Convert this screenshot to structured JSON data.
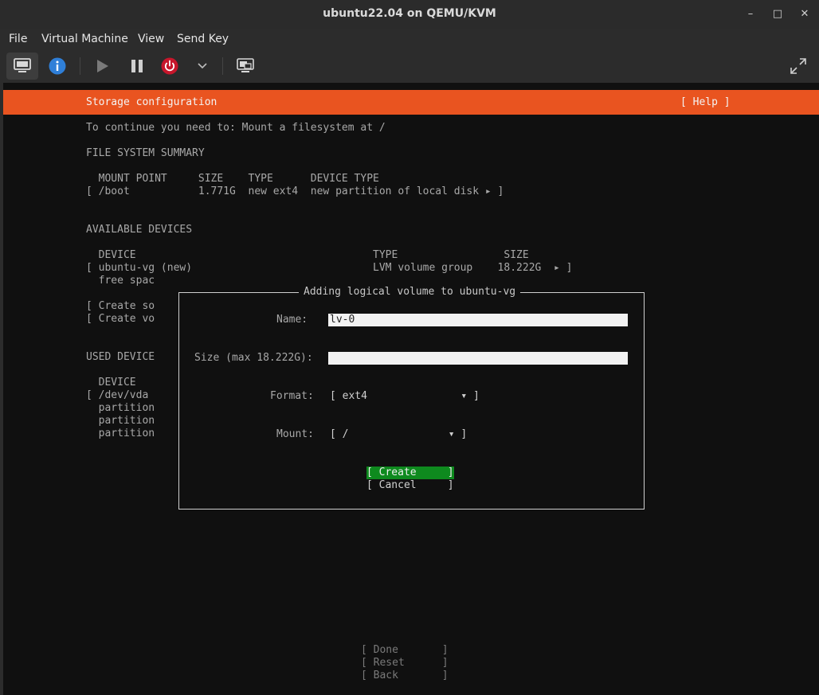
{
  "window": {
    "title": "ubuntu22.04 on QEMU/KVM",
    "minimize": "–",
    "maximize": "□",
    "close": "✕"
  },
  "menubar": [
    "File",
    "Virtual Machine",
    "View",
    "Send Key"
  ],
  "toolbar": {
    "icons": [
      "console-icon",
      "info-icon",
      "play-icon",
      "pause-icon",
      "power-icon",
      "chevron-down-icon",
      "screenshot-icon",
      "fullscreen-icon"
    ],
    "info_color": "#2f7fd8",
    "power_color": "#c7162b"
  },
  "installer": {
    "header_title": "Storage configuration",
    "help": "[ Help ]",
    "header_color": "#e95420",
    "instruction": "To continue you need to: Mount a filesystem at /",
    "fs_summary_heading": "FILE SYSTEM SUMMARY",
    "fs_summary_columns": "  MOUNT POINT     SIZE    TYPE      DEVICE TYPE",
    "fs_summary_row": "[ /boot           1.771G  new ext4  new partition of local disk ▸ ]",
    "available_heading": "AVAILABLE DEVICES",
    "available_columns": "  DEVICE                                      TYPE                 SIZE",
    "available_row": "[ ubuntu-vg (new)                             LVM volume group    18.222G  ▸ ]",
    "free_space": "  free spac",
    "create_so": "[ Create so",
    "create_vo": "[ Create vo",
    "used_heading": "USED DEVICE",
    "used_device_col": "  DEVICE",
    "used_vda": "[ /dev/vda",
    "partition_1": "  partition",
    "partition_2": "  partition",
    "partition_3": "  partition",
    "done": "[ Done       ]",
    "reset": "[ Reset      ]",
    "back": "[ Back       ]"
  },
  "dialog": {
    "title": "Adding logical volume to ubuntu-vg",
    "name_label": "Name:",
    "name_value": "lv-0",
    "size_label": "Size (max 18.222G):",
    "size_value": "",
    "format_label": "Format:",
    "format_value": "[ ext4               ▾ ]",
    "mount_label": "Mount:",
    "mount_value": "[ /                ▾ ]",
    "create": "[ Create     ]",
    "cancel": "[ Cancel     ]",
    "create_color": "#0e8a1e"
  }
}
